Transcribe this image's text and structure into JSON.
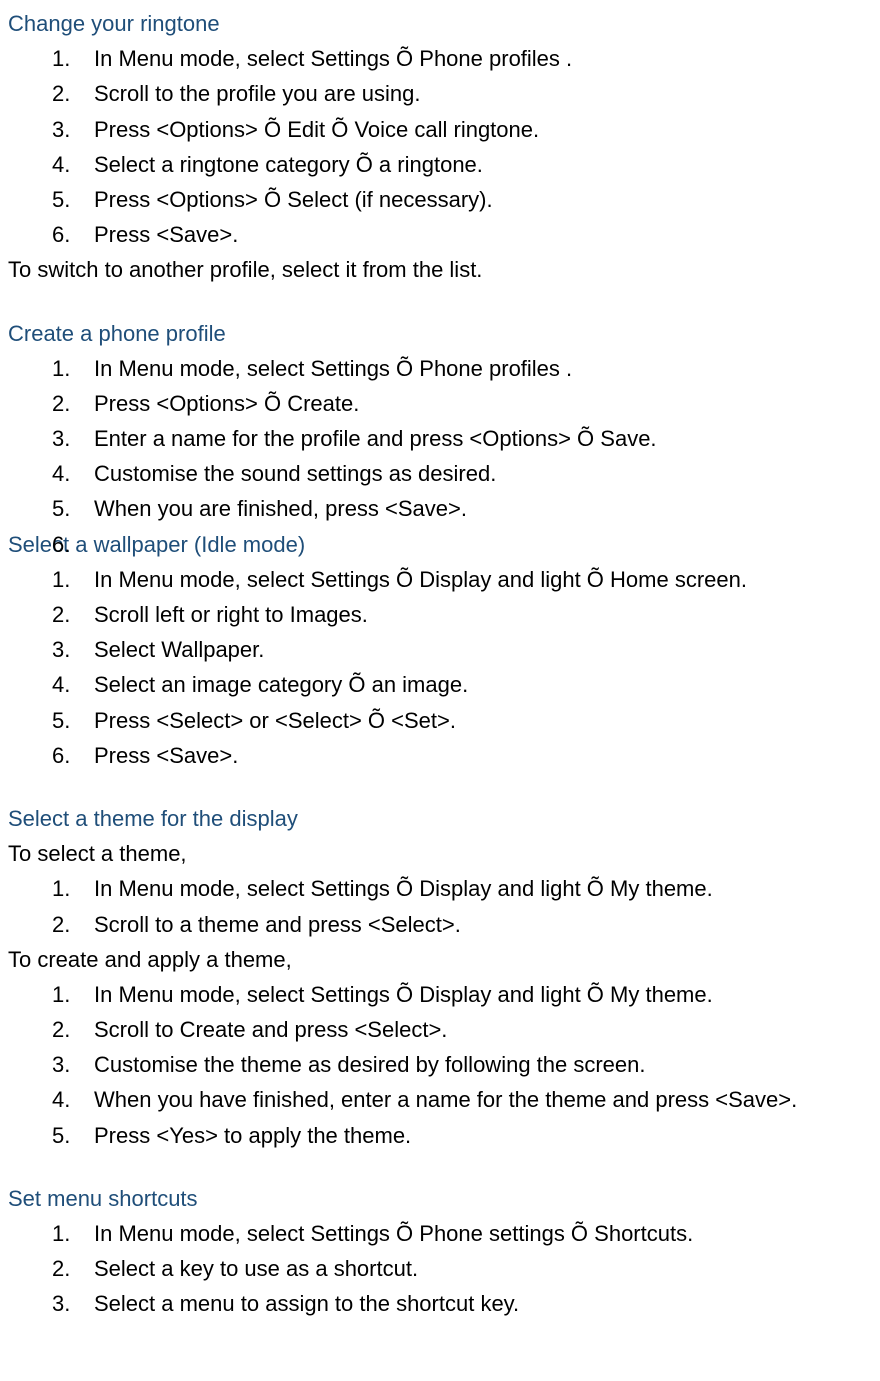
{
  "sections": [
    {
      "heading": "Change your ringtone",
      "intro": null,
      "list": [
        "In Menu mode, select Settings Õ Phone profiles .",
        "Scroll to the profile you are using.",
        "Press <Options> Õ Edit Õ Voice call ringtone.",
        "Select a ringtone category Õ a ringtone.",
        "Press <Options> Õ Select (if necessary).",
        "Press <Save>."
      ],
      "outro": "To switch to another profile, select it from the list.",
      "top_gap": false
    },
    {
      "heading": "Create a phone profile",
      "intro": null,
      "list": [
        "In Menu mode, select Settings Õ Phone profiles .",
        "Press <Options> Õ Create.",
        "Enter a name for the profile and press <Options> Õ Save.",
        "Customise the sound settings as desired.",
        "When you are finished, press <Save>.",
        ""
      ],
      "outro": null,
      "top_gap": true
    },
    {
      "heading": "Select a wallpaper (Idle mode)",
      "intro": null,
      "list": [
        "In Menu mode, select Settings Õ Display and light Õ Home screen.",
        "Scroll left or right to Images.",
        "Select Wallpaper.",
        "Select an image category Õ an image.",
        "Press <Select> or <Select> Õ <Set>.",
        "Press <Save>."
      ],
      "outro": null,
      "top_gap": false
    },
    {
      "heading": "Select a theme for the display",
      "intro": "To select a theme,",
      "list": [
        "In Menu mode, select Settings Õ Display and light Õ My theme.",
        "Scroll to a theme and press <Select>."
      ],
      "outro": null,
      "top_gap": true
    },
    {
      "heading": null,
      "intro": "To create and apply a theme,",
      "list": [
        "In Menu mode, select Settings Õ Display and light Õ My theme.",
        "Scroll to Create and press <Select>.",
        "Customise the theme as desired by following the screen.",
        "When you have finished, enter a name for the theme and press <Save>.",
        "Press <Yes> to apply the theme."
      ],
      "outro": null,
      "top_gap": false
    },
    {
      "heading": "Set menu shortcuts",
      "intro": null,
      "list": [
        "In Menu mode, select Settings Õ Phone settings Õ Shortcuts.",
        "Select a key to use as a shortcut.",
        "Select a menu to assign to the shortcut key."
      ],
      "outro": null,
      "top_gap": true
    }
  ]
}
